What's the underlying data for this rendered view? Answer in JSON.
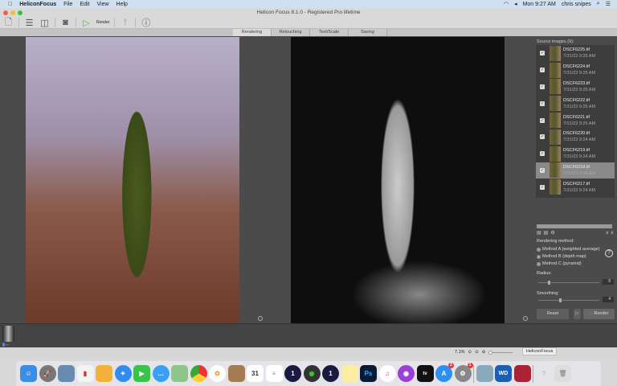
{
  "menubar": {
    "apple": "",
    "app": "HeliconFocus",
    "items": [
      "File",
      "Edit",
      "View",
      "Help"
    ],
    "clock": "Mon 9:27 AM",
    "user": "chris snipes"
  },
  "window": {
    "title": "Helicon Focus 8.1.0 - Registered Pro lifetime"
  },
  "toolbar": {
    "render_label": "Render"
  },
  "tabs": [
    "Rendering",
    "Retouching",
    "Text/Scale",
    "Saving"
  ],
  "sidebar": {
    "source_title": "Source images (9):",
    "images": [
      {
        "name": "DSCF6225.tif",
        "date": "7/31/23 9:25 AM",
        "checked": true
      },
      {
        "name": "DSCF6224.tif",
        "date": "7/31/23 9:25 AM",
        "checked": true
      },
      {
        "name": "DSCF6223.tif",
        "date": "7/31/23 9:25 AM",
        "checked": true
      },
      {
        "name": "DSCF6222.tif",
        "date": "7/31/23 9:25 AM",
        "checked": true
      },
      {
        "name": "DSCF6221.tif",
        "date": "7/31/23 9:25 AM",
        "checked": true
      },
      {
        "name": "DSCF6220.tif",
        "date": "7/31/23 9:24 AM",
        "checked": true
      },
      {
        "name": "DSCF6219.tif",
        "date": "7/31/23 9:24 AM",
        "checked": true
      },
      {
        "name": "DSCF6218.tif",
        "date": "7/31/23 9:24 AM",
        "checked": true,
        "selected": true
      },
      {
        "name": "DSCF6217.tif",
        "date": "7/31/23 9:24 AM",
        "checked": true
      }
    ],
    "rendering_method_label": "Rendering method:",
    "methods": [
      "Method A (weighted average)",
      "Method B (depth map)",
      "Method C (pyramid)"
    ],
    "selected_method": 1,
    "radius_label": "Radius:",
    "radius": "8",
    "smoothing_label": "Smoothing:",
    "smoothing": "4",
    "reset_label": "Reset",
    "render_label": "Render"
  },
  "status": {
    "zoom": "7.1%",
    "tooltip": "HeliconFocus"
  },
  "dock": {
    "badges": {
      "app-store": "2",
      "system-preferences": "1"
    },
    "calendar_day": "31"
  }
}
